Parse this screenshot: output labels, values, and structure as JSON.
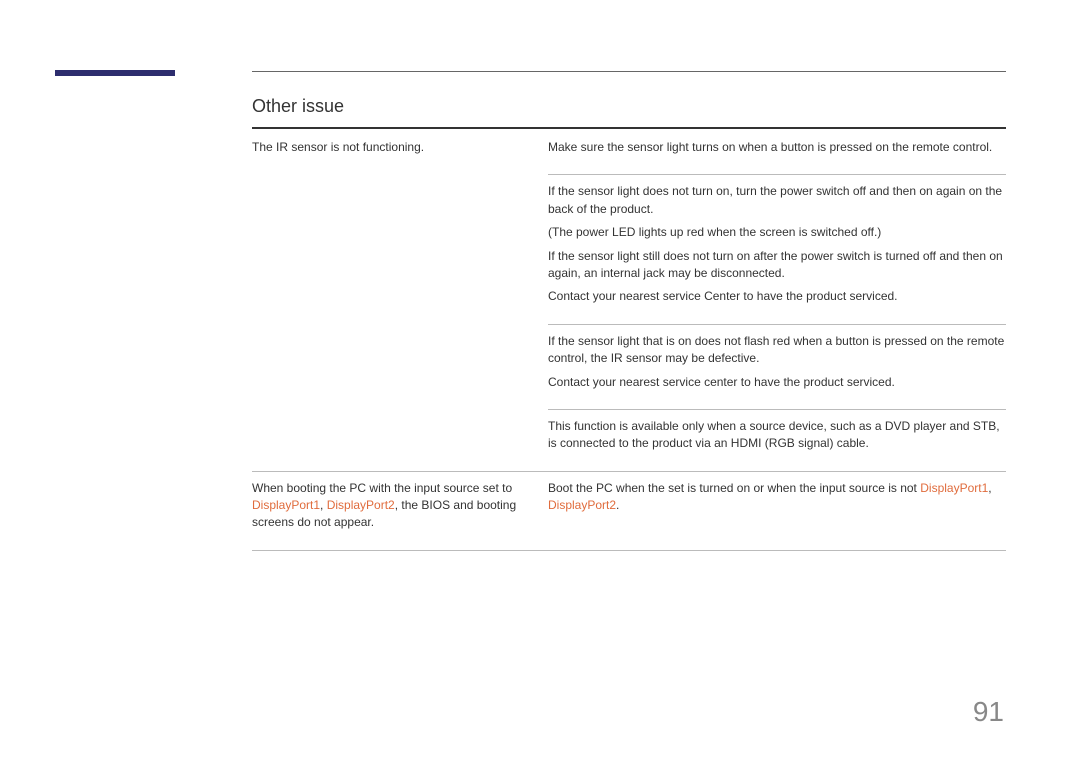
{
  "section_title": "Other issue",
  "row1": {
    "issue": "The IR sensor is not functioning.",
    "b1": {
      "p1": "Make sure the sensor light turns on when a button is pressed on the remote control."
    },
    "b2": {
      "p1": "If the sensor light does not turn on, turn the power switch off and then on again on the back of the product.",
      "p2": "(The power LED lights up red when the screen is switched off.)",
      "p3": "If the sensor light still does not turn on after the power switch is turned off and then on again, an internal jack may be disconnected.",
      "p4": "Contact your nearest service Center to have the product serviced."
    },
    "b3": {
      "p1": "If the sensor light that is on does not flash red when a button is pressed on the remote control, the IR sensor may be defective.",
      "p2": "Contact your nearest service center to have the product serviced."
    },
    "b4": {
      "p1": "This function is available only when a source device, such as a DVD player and STB, is connected to the product via an HDMI (RGB signal) cable."
    }
  },
  "row2": {
    "issue_part1": "When booting the PC with the input source set to ",
    "issue_dp1": "DisplayPort1",
    "issue_sep": ", ",
    "issue_dp2": "DisplayPort2",
    "issue_part2": ", the BIOS and booting screens do not appear.",
    "sol_part1": "Boot the PC when the set is turned on or when the input source is not ",
    "sol_dp1": "DisplayPort1",
    "sol_sep": ", ",
    "sol_dp2": "DisplayPort2",
    "sol_end": "."
  },
  "page_number": "91"
}
